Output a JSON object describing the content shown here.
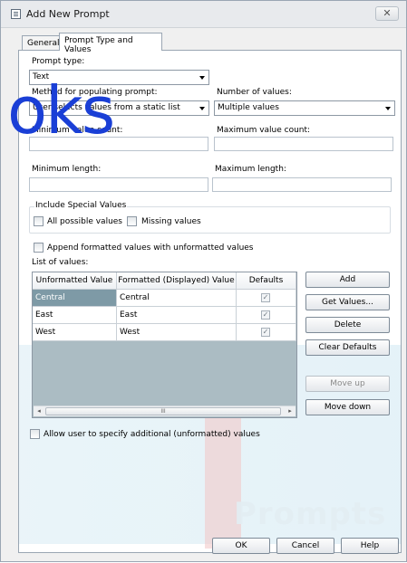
{
  "watermark": {
    "top_text": "oks",
    "bottom_text": "Prompts"
  },
  "window": {
    "title": "Add New Prompt",
    "close_symbol": "✕"
  },
  "tabs": [
    {
      "label": "General"
    },
    {
      "label": "Prompt Type and Values"
    }
  ],
  "form": {
    "prompt_type_label": "Prompt type:",
    "prompt_type_value": "Text",
    "method_label": "Method for populating prompt:",
    "method_value": "User selects values from a static list",
    "num_values_label": "Number of values:",
    "num_values_value": "Multiple values",
    "min_count_label": "Minimum value count:",
    "max_count_label": "Maximum value count:",
    "min_length_label": "Minimum length:",
    "max_length_label": "Maximum length:",
    "special_group_label": "Include Special Values",
    "all_possible_label": "All possible values",
    "missing_label": "Missing values",
    "append_label": "Append formatted values with unformatted values",
    "list_label": "List of values:",
    "allow_label": "Allow user to specify additional (unformatted) values"
  },
  "grid": {
    "headers": [
      "Unformatted Value",
      "Formatted (Displayed) Value",
      "Defaults"
    ],
    "rows": [
      {
        "unformatted": "Central",
        "formatted": "Central",
        "default": true
      },
      {
        "unformatted": "East",
        "formatted": "East",
        "default": true
      },
      {
        "unformatted": "West",
        "formatted": "West",
        "default": true
      }
    ],
    "check_symbol": "✓",
    "scroll_grip": "III",
    "scroll_left": "◂",
    "scroll_right": "▸"
  },
  "side_buttons": {
    "add": "Add",
    "get_values": "Get Values...",
    "delete": "Delete",
    "clear_defaults": "Clear Defaults",
    "move_up": "Move up",
    "move_down": "Move down"
  },
  "footer_buttons": {
    "ok": "OK",
    "cancel": "Cancel",
    "help": "Help"
  }
}
